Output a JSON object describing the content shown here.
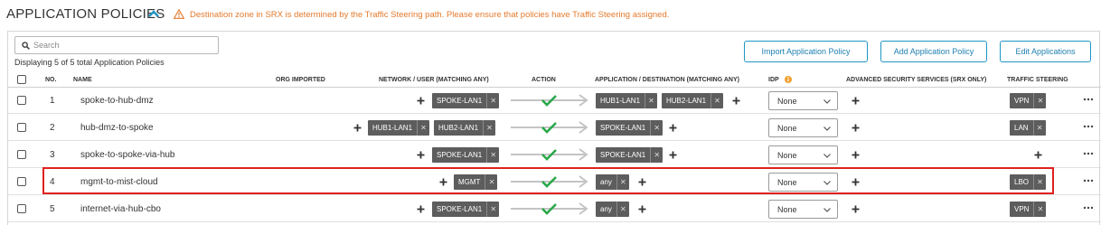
{
  "header": {
    "title": "APPLICATION POLICIES",
    "warning": "Destination zone in SRX is determined by the Traffic Steering path. Please ensure that policies have Traffic Steering assigned."
  },
  "toolbar": {
    "search_placeholder": "Search",
    "display_count": "Displaying 5 of 5 total Application Policies",
    "import_label": "Import Application Policy",
    "add_label": "Add Application Policy",
    "edit_label": "Edit Applications"
  },
  "columns": {
    "no": "NO.",
    "name": "NAME",
    "org_imported": "ORG IMPORTED",
    "network": "NETWORK / USER (MATCHING ANY)",
    "action": "ACTION",
    "application": "APPLICATION / DESTINATION (MATCHING ANY)",
    "idp": "IDP",
    "advanced": "ADVANCED SECURITY SERVICES (SRX ONLY)",
    "steering": "TRAFFIC STEERING"
  },
  "rows": [
    {
      "no": "1",
      "name": "spoke-to-hub-dmz",
      "network": [
        "SPOKE-LAN1"
      ],
      "application": [
        "HUB1-LAN1",
        "HUB2-LAN1"
      ],
      "idp": "None",
      "steering": "VPN"
    },
    {
      "no": "2",
      "name": "hub-dmz-to-spoke",
      "network": [
        "HUB1-LAN1",
        "HUB2-LAN1"
      ],
      "application": [
        "SPOKE-LAN1"
      ],
      "idp": "None",
      "steering": "LAN"
    },
    {
      "no": "3",
      "name": "spoke-to-spoke-via-hub",
      "network": [
        "SPOKE-LAN1"
      ],
      "application": [
        "SPOKE-LAN1"
      ],
      "idp": "None",
      "steering": ""
    },
    {
      "no": "4",
      "name": "mgmt-to-mist-cloud",
      "network": [
        "MGMT"
      ],
      "application": [
        "any"
      ],
      "idp": "None",
      "steering": "LBO"
    },
    {
      "no": "5",
      "name": "internet-via-hub-cbo",
      "network": [
        "SPOKE-LAN1"
      ],
      "application": [
        "any"
      ],
      "idp": "None",
      "steering": "VPN"
    }
  ],
  "colors": {
    "accent": "#1e95c6",
    "warning": "#e47a2c",
    "tag_bg": "#5d5d5d",
    "allow_check": "#2aa84a",
    "highlight": "#e02020"
  }
}
